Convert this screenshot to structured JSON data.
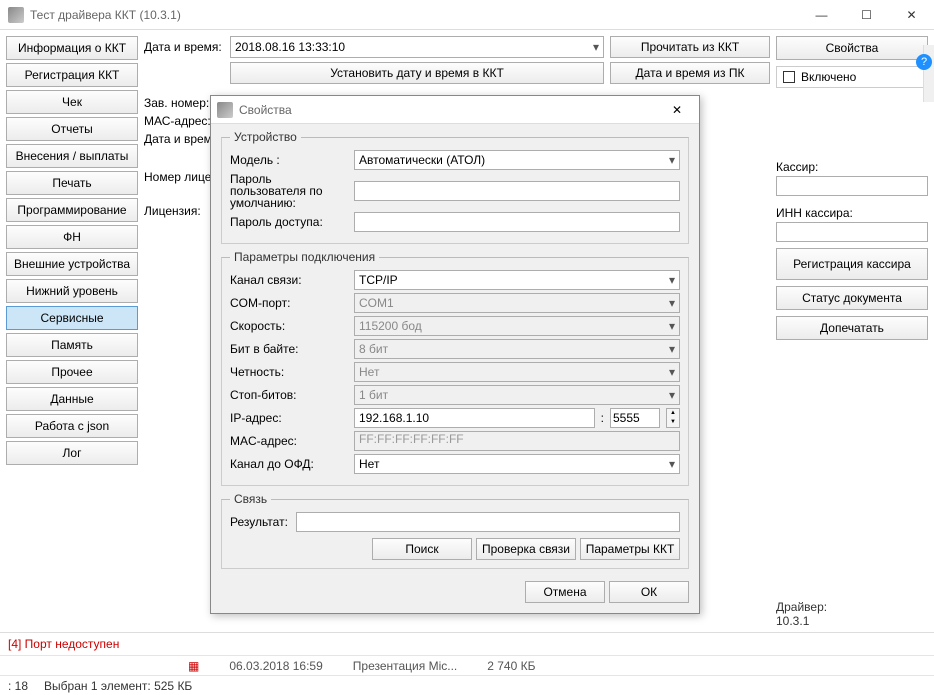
{
  "window": {
    "title": "Тест драйвера ККТ (10.3.1)"
  },
  "sidebar": [
    "Информация о ККТ",
    "Регистрация ККТ",
    "Чек",
    "Отчеты",
    "Внесения / выплаты",
    "Печать",
    "Программирование",
    "ФН",
    "Внешние устройства",
    "Нижний уровень",
    "Сервисные",
    "Память",
    "Прочее",
    "Данные",
    "Работа с json",
    "Лог"
  ],
  "sidebar_active": 10,
  "center": {
    "datetime_label": "Дата и время:",
    "datetime_value": "2018.08.16 13:33:10",
    "read_kkt": "Прочитать из ККТ",
    "set_dt_kkt": "Установить дату и время в ККТ",
    "dt_from_pc": "Дата и время из ПК",
    "serial_label": "Зав. номер:",
    "mac_label": "МАС-адрес:",
    "dt_label2": "Дата и время:",
    "license_num_label": "Номер лицензи",
    "license_label": "Лицензия:",
    "memory_btn": "память"
  },
  "right": {
    "properties": "Свойства",
    "enabled": "Включено",
    "cashier": "Кассир:",
    "cashier_inn": "ИНН кассира:",
    "reg_cashier": "Регистрация кассира",
    "doc_status": "Статус документа",
    "reprint": "Допечатать",
    "driver_label": "Драйвер:",
    "driver_ver": "10.3.1"
  },
  "modal": {
    "title": "Свойства",
    "device_group": "Устройство",
    "model_label": "Модель :",
    "model_value": "Автоматически (АТОЛ)",
    "user_pwd": "Пароль пользователя по умолчанию:",
    "access_pwd": "Пароль доступа:",
    "conn_group": "Параметры подключения",
    "channel_label": "Канал связи:",
    "channel_value": "TCP/IP",
    "com_label": "COM-порт:",
    "com_value": "COM1",
    "speed_label": "Скорость:",
    "speed_value": "115200 бод",
    "bits_label": "Бит в байте:",
    "bits_value": "8 бит",
    "parity_label": "Четность:",
    "parity_value": "Нет",
    "stop_label": "Стоп-битов:",
    "stop_value": "1 бит",
    "ip_label": "IP-адрес:",
    "ip_value": "192.168.1.10",
    "port_value": "5555",
    "mac_label": "MAC-адрес:",
    "mac_value": "FF:FF:FF:FF:FF:FF",
    "ofd_label": "Канал до ОФД:",
    "ofd_value": "Нет",
    "link_group": "Связь",
    "result_label": "Результат:",
    "search": "Поиск",
    "check_conn": "Проверка связи",
    "kkt_params": "Параметры ККТ",
    "cancel": "Отмена",
    "ok": "ОК"
  },
  "status": {
    "error": "[4] Порт недоступен",
    "row_date": "06.03.2018 16:59",
    "row_name": "Презентация Mic...",
    "row_size": "2 740 КБ",
    "sel_prefix": ": 18",
    "sel": "Выбран 1 элемент: 525 КБ"
  }
}
